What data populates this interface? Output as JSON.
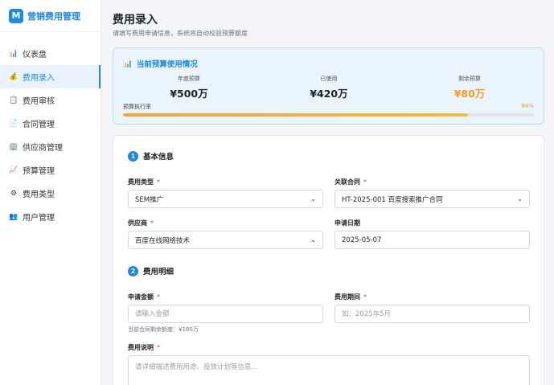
{
  "brand": {
    "logo_letter": "M",
    "name": "营销费用管理"
  },
  "nav": [
    {
      "label": "仪表盘",
      "icon": "chart-icon",
      "glyph": "📊",
      "active": false
    },
    {
      "label": "费用录入",
      "icon": "money-bag-icon",
      "glyph": "💰",
      "active": true
    },
    {
      "label": "费用审核",
      "icon": "clipboard-icon",
      "glyph": "📋",
      "active": false
    },
    {
      "label": "合同管理",
      "icon": "document-icon",
      "glyph": "📄",
      "active": false
    },
    {
      "label": "供应商管理",
      "icon": "building-icon",
      "glyph": "🏢",
      "active": false
    },
    {
      "label": "预算管理",
      "icon": "trend-icon",
      "glyph": "📈",
      "active": false
    },
    {
      "label": "费用类型",
      "icon": "gear-icon",
      "glyph": "⚙",
      "active": false
    },
    {
      "label": "用户管理",
      "icon": "users-icon",
      "glyph": "👥",
      "active": false
    }
  ],
  "page": {
    "title": "费用录入",
    "subtitle": "请填写费用申请信息，系统将自动校验预算额度"
  },
  "budget": {
    "title": "当前预算使用情况",
    "annual_label": "年度预算",
    "annual_value": "¥500万",
    "used_label": "已使用",
    "used_value": "¥420万",
    "remaining_label": "剩余预算",
    "remaining_value": "¥80万",
    "remaining_color": "#f59a23",
    "rate_label": "预算执行率",
    "rate_pct": "84%",
    "rate_fraction": 0.84
  },
  "form": {
    "section1": {
      "num": "1",
      "title": "基本信息"
    },
    "section2": {
      "num": "2",
      "title": "费用明细"
    },
    "expense_type": {
      "label": "费用类型",
      "value": "SEM推广"
    },
    "contract": {
      "label": "关联合同",
      "value": "HT-2025-001 百度搜索推广合同"
    },
    "supplier": {
      "label": "供应商",
      "value": "百度在线网络技术"
    },
    "apply_date": {
      "label": "申请日期",
      "value": "2025-05-07"
    },
    "amount": {
      "label": "申请金额",
      "placeholder": "请输入金额",
      "hint": "当前合同剩余额度：¥180万"
    },
    "period": {
      "label": "费用期间",
      "placeholder": "如：2025年5月"
    },
    "description": {
      "label": "费用说明",
      "placeholder": "请详细描述费用用途、投放计划等信息..."
    },
    "required_mark": "*"
  },
  "colors": {
    "accent": "#1e88e5",
    "warning": "#f59a23",
    "required": "#e53935"
  }
}
